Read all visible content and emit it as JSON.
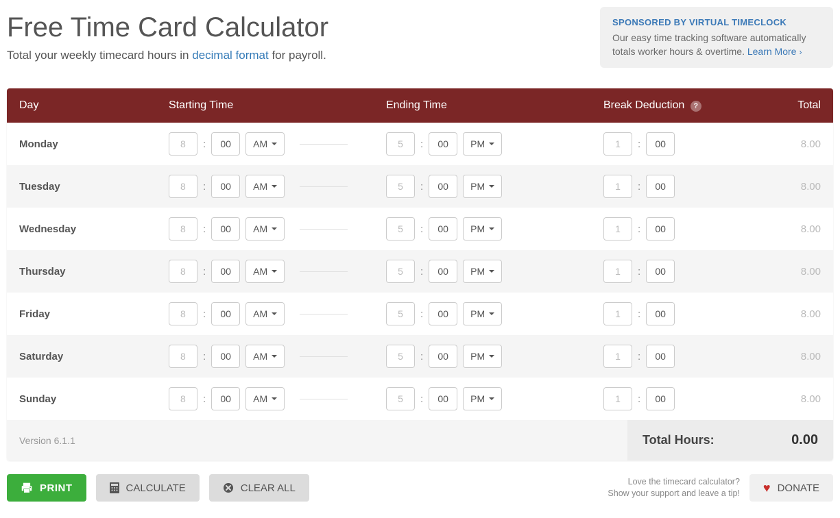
{
  "header": {
    "title": "Free Time Card Calculator",
    "subtitle_pre": "Total your weekly timecard hours in ",
    "subtitle_link": "decimal format",
    "subtitle_post": " for payroll."
  },
  "sponsor": {
    "title": "SPONSORED BY VIRTUAL TIMECLOCK",
    "body": "Our easy time tracking software automatically totals worker hours & overtime. ",
    "link": "Learn More"
  },
  "columns": {
    "day": "Day",
    "start": "Starting Time",
    "end": "Ending Time",
    "break": "Break Deduction",
    "total": "Total"
  },
  "rows": [
    {
      "day": "Monday",
      "start_h": "8",
      "start_m": "00",
      "start_ap": "AM",
      "end_h": "5",
      "end_m": "00",
      "end_ap": "PM",
      "break_h": "1",
      "break_m": "00",
      "total": "8.00"
    },
    {
      "day": "Tuesday",
      "start_h": "8",
      "start_m": "00",
      "start_ap": "AM",
      "end_h": "5",
      "end_m": "00",
      "end_ap": "PM",
      "break_h": "1",
      "break_m": "00",
      "total": "8.00"
    },
    {
      "day": "Wednesday",
      "start_h": "8",
      "start_m": "00",
      "start_ap": "AM",
      "end_h": "5",
      "end_m": "00",
      "end_ap": "PM",
      "break_h": "1",
      "break_m": "00",
      "total": "8.00"
    },
    {
      "day": "Thursday",
      "start_h": "8",
      "start_m": "00",
      "start_ap": "AM",
      "end_h": "5",
      "end_m": "00",
      "end_ap": "PM",
      "break_h": "1",
      "break_m": "00",
      "total": "8.00"
    },
    {
      "day": "Friday",
      "start_h": "8",
      "start_m": "00",
      "start_ap": "AM",
      "end_h": "5",
      "end_m": "00",
      "end_ap": "PM",
      "break_h": "1",
      "break_m": "00",
      "total": "8.00"
    },
    {
      "day": "Saturday",
      "start_h": "8",
      "start_m": "00",
      "start_ap": "AM",
      "end_h": "5",
      "end_m": "00",
      "end_ap": "PM",
      "break_h": "1",
      "break_m": "00",
      "total": "8.00"
    },
    {
      "day": "Sunday",
      "start_h": "8",
      "start_m": "00",
      "start_ap": "AM",
      "end_h": "5",
      "end_m": "00",
      "end_ap": "PM",
      "break_h": "1",
      "break_m": "00",
      "total": "8.00"
    }
  ],
  "footer": {
    "version": "Version 6.1.1",
    "total_label": "Total Hours:",
    "total_value": "0.00"
  },
  "buttons": {
    "print": "PRINT",
    "calculate": "CALCULATE",
    "clear": "CLEAR ALL",
    "donate": "DONATE"
  },
  "donate_text": {
    "line1": "Love the timecard calculator?",
    "line2": "Show your support and leave a tip!"
  }
}
